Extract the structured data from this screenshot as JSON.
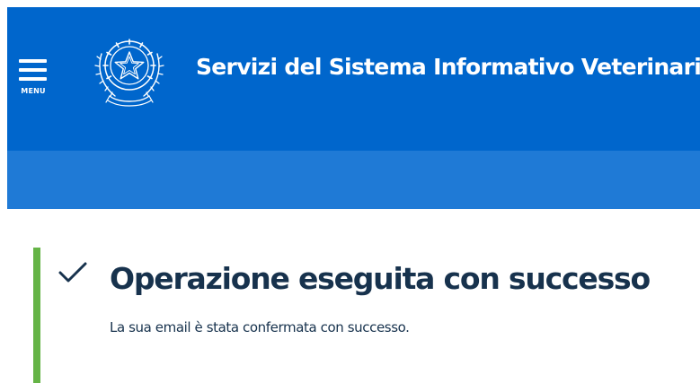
{
  "header": {
    "menu_label": "MENU",
    "site_title": "Servizi del Sistema Informativo Veterinario",
    "emblem_icon": "italian-republic-emblem-icon",
    "menu_icon": "hamburger-icon",
    "colors": {
      "primary": "#0066cc",
      "secondary": "#1f7ad6"
    }
  },
  "alert": {
    "status": "success",
    "status_icon": "check-icon",
    "title": "Operazione eseguita con successo",
    "message": "La sua email è stata confermata con successo.",
    "colors": {
      "accent": "#65b446",
      "text": "#17324d"
    }
  }
}
